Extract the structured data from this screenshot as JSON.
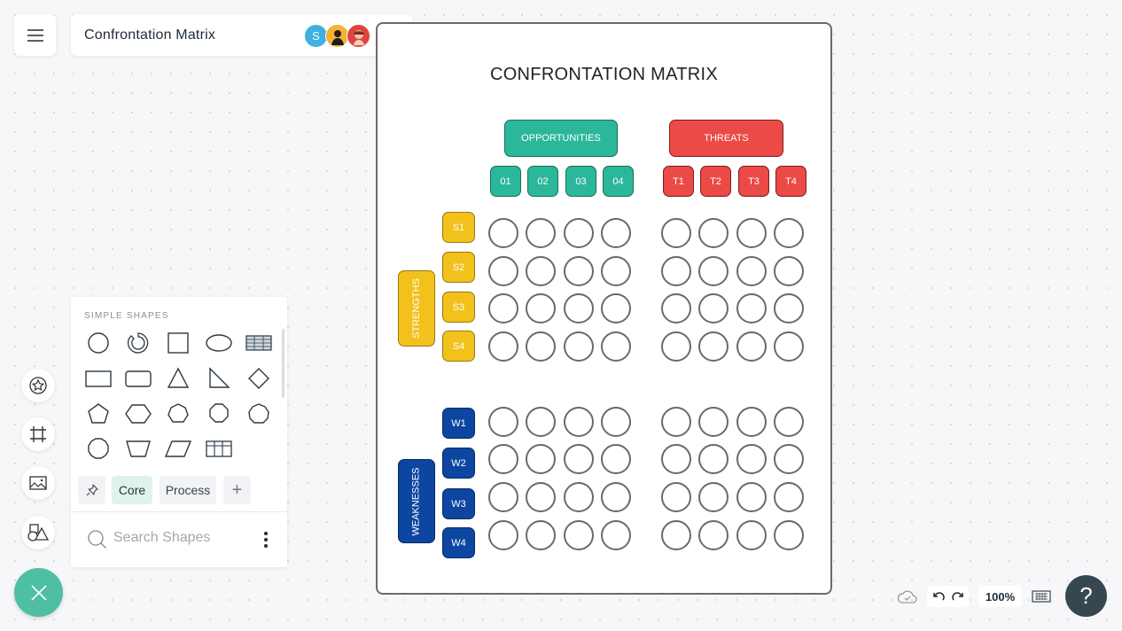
{
  "header": {
    "title": "Confrontation Matrix",
    "avatars": [
      {
        "initial": "S",
        "color": "#3fb0e0"
      },
      {
        "initial": "",
        "color": "#f3b23a"
      },
      {
        "initial": "",
        "color": "#e0443f"
      }
    ],
    "icons": {
      "menu": "hamburger-icon",
      "call": "phone-icon"
    }
  },
  "document": {
    "title": "CONFRONTATION MATRIX",
    "opportunities": {
      "label": "OPPORTUNITIES",
      "items": [
        "01",
        "02",
        "03",
        "04"
      ],
      "color": "#2bb79a"
    },
    "threats": {
      "label": "THREATS",
      "items": [
        "T1",
        "T2",
        "T3",
        "T4"
      ],
      "color": "#eb4a47"
    },
    "strengths": {
      "label": "STRENGTHS",
      "items": [
        "S1",
        "S2",
        "S3",
        "S4"
      ],
      "color": "#f2c11b"
    },
    "weaknesses": {
      "label": "WEAKNESSES",
      "items": [
        "W1",
        "W2",
        "W3",
        "W4"
      ],
      "color": "#0d46a0"
    }
  },
  "left_rail": {
    "items": [
      "sticker-icon",
      "frame-icon",
      "image-icon",
      "shapes-icon"
    ],
    "fab": "close-icon"
  },
  "shapes_panel": {
    "heading": "SIMPLE SHAPES",
    "shapes": [
      "circle",
      "donut",
      "square",
      "ellipse",
      "table-striped",
      "rectangle",
      "rounded-rectangle",
      "triangle",
      "right-triangle",
      "diamond",
      "pentagon",
      "hexagon",
      "heptagon",
      "octagon",
      "nonagon",
      "decagon",
      "trapezoid",
      "parallelogram",
      "table-grid"
    ],
    "tabs": {
      "pin": "pin-icon",
      "core": "Core",
      "process": "Process",
      "add": "+"
    },
    "search": {
      "placeholder": "Search Shapes",
      "value": ""
    }
  },
  "bottom_bar": {
    "zoom": "100%",
    "help": "?"
  }
}
